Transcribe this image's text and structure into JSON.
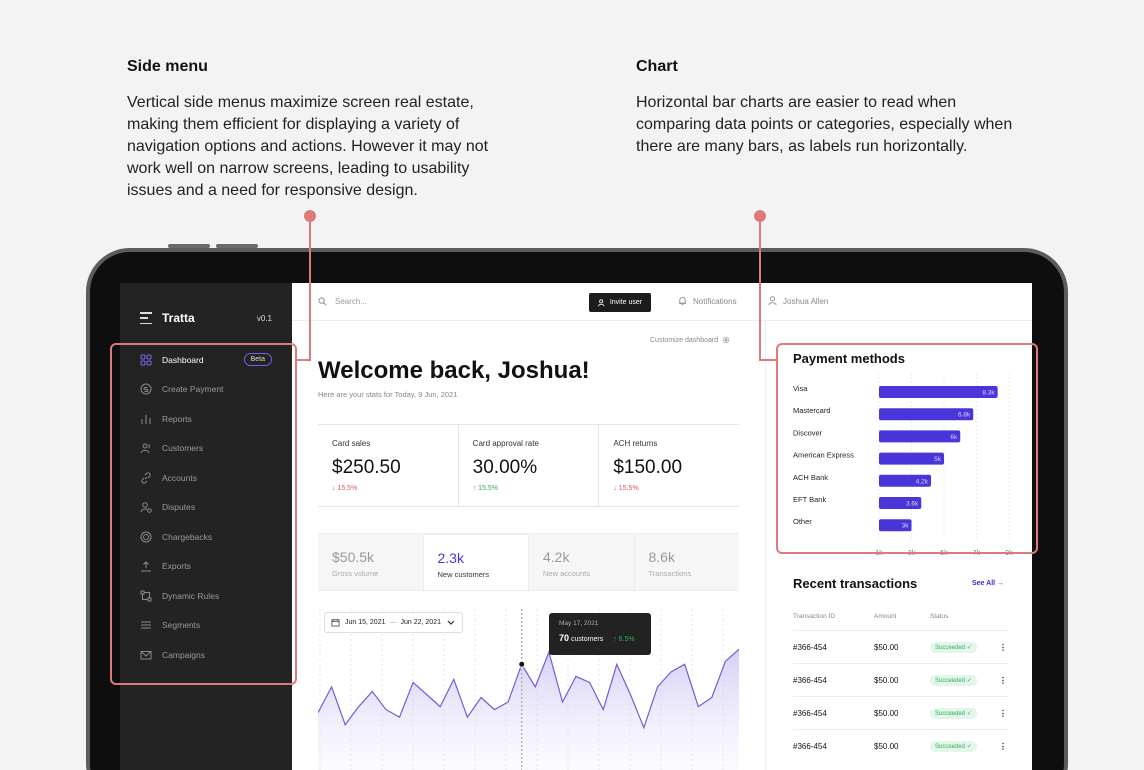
{
  "annotations": {
    "left": {
      "title": "Side menu",
      "body": "Vertical side menus maximize screen real estate, making them efficient for displaying a variety of navigation options and actions. However it may not work well on narrow screens, leading to usability issues and a need for responsive design."
    },
    "right": {
      "title": "Chart",
      "body": "Horizontal bar charts are easier to read when comparing data points or categories, especially when there are many bars, as labels run horizontally."
    },
    "accent": "#e07a7a"
  },
  "sidebar": {
    "app_name": "Tratta",
    "version": "v0.1",
    "items": [
      {
        "label": "Dashboard",
        "icon": "dashboard-icon",
        "active": true,
        "badge": "Beta"
      },
      {
        "label": "Create Payment",
        "icon": "dollar-circle-icon"
      },
      {
        "label": "Reports",
        "icon": "bar-chart-icon"
      },
      {
        "label": "Customers",
        "icon": "users-icon"
      },
      {
        "label": "Accounts",
        "icon": "link-icon"
      },
      {
        "label": "Disputes",
        "icon": "user-warning-icon"
      },
      {
        "label": "Chargebacks",
        "icon": "refund-icon"
      },
      {
        "label": "Exports",
        "icon": "upload-icon"
      },
      {
        "label": "Dynamic Rules",
        "icon": "workflow-icon"
      },
      {
        "label": "Segments",
        "icon": "list-icon"
      },
      {
        "label": "Campaigns",
        "icon": "mail-icon"
      }
    ]
  },
  "topbar": {
    "search_placeholder": "Search...",
    "invite_label": "Invite user",
    "notifications_label": "Notifications",
    "user_name": "Joshua Allen"
  },
  "main": {
    "customize_label": "Customize dashboard",
    "welcome": "Welcome back, Joshua!",
    "subtitle": "Here are your stats for Today, 9 Jun, 2021",
    "stats": [
      {
        "label": "Card sales",
        "value": "$250.50",
        "change": "↓ 15.5%",
        "direction": "down"
      },
      {
        "label": "Card approval rate",
        "value": "30.00%",
        "change": "↑ 15.5%",
        "direction": "up"
      },
      {
        "label": "ACH returns",
        "value": "$150.00",
        "change": "↓ 15.5%",
        "direction": "down"
      }
    ],
    "tabs": [
      {
        "value": "$50.5k",
        "label": "Gross volume"
      },
      {
        "value": "2.3k",
        "label": "New customers",
        "active": true
      },
      {
        "value": "4.2k",
        "label": "New accounts"
      },
      {
        "value": "8.6k",
        "label": "Transactions"
      }
    ],
    "date_from": "Jun 15, 2021",
    "date_sep": "—",
    "date_to": "Jun 22, 2021",
    "tooltip": {
      "date": "May 17, 2021",
      "count": "70",
      "unit": "customers",
      "change": "↑ 6.5%"
    },
    "line_color": "#6d5fd6"
  },
  "chart_data": [
    {
      "type": "bar",
      "orientation": "horizontal",
      "title": "Payment methods",
      "categories": [
        "Visa",
        "Mastercard",
        "Discover",
        "American Express",
        "ACH Bank",
        "EFT Bank",
        "Other"
      ],
      "values": [
        8.3,
        6.8,
        6,
        5,
        4.2,
        3.6,
        3
      ],
      "value_labels": [
        "8.3k",
        "6.8k",
        "6k",
        "5k",
        "4.2k",
        "3.6k",
        "3k"
      ],
      "x_ticks": [
        "1k",
        "3k",
        "5k",
        "7k",
        "9k"
      ],
      "xlim": [
        1,
        9
      ],
      "color": "#4a36d8"
    },
    {
      "type": "area",
      "series": [
        {
          "values": [
            38,
            55,
            30,
            42,
            52,
            40,
            35,
            58,
            50,
            42,
            60,
            35,
            48,
            40,
            45,
            70,
            55,
            78,
            45,
            62,
            58,
            40,
            70,
            50,
            28,
            55,
            65,
            70,
            42,
            48,
            72,
            80
          ]
        }
      ],
      "highlight_index": 15
    }
  ],
  "recent": {
    "title": "Recent transactions",
    "see_all": "See All →",
    "headers": [
      "Transaction ID",
      "Amount",
      "Status"
    ],
    "rows": [
      {
        "id": "#366-454",
        "amount": "$50.00",
        "status": "Succeeded ✓"
      },
      {
        "id": "#366-454",
        "amount": "$50.00",
        "status": "Succeeded ✓"
      },
      {
        "id": "#366-454",
        "amount": "$50.00",
        "status": "Succeeded ✓"
      },
      {
        "id": "#366-454",
        "amount": "$50.00",
        "status": "Succeeded ✓"
      }
    ]
  }
}
